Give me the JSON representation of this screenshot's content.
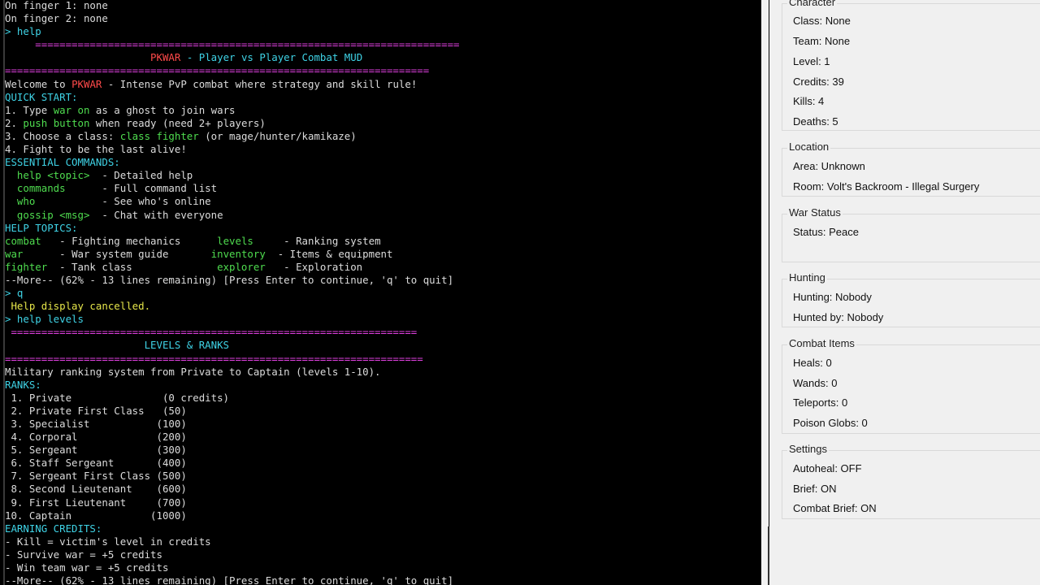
{
  "terminal": {
    "lines": [
      [
        {
          "t": "On finger 1: none",
          "c": "default"
        }
      ],
      [
        {
          "t": "On finger 2: none",
          "c": "default"
        }
      ],
      [
        {
          "t": "> help",
          "c": "cyan"
        }
      ],
      [
        {
          "t": "     ======================================================================",
          "c": "magenta"
        }
      ],
      [
        {
          "t": "                        ",
          "c": "default"
        },
        {
          "t": "PKWAR",
          "c": "red"
        },
        {
          "t": " - Player vs Player Combat MUD",
          "c": "cyan"
        }
      ],
      [
        {
          "t": "======================================================================",
          "c": "magenta"
        }
      ],
      [
        {
          "t": "Welcome to ",
          "c": "default"
        },
        {
          "t": "PKWAR",
          "c": "red"
        },
        {
          "t": " - Intense PvP combat where strategy and skill rule!",
          "c": "default"
        }
      ],
      [
        {
          "t": "QUICK START:",
          "c": "cyan"
        }
      ],
      [
        {
          "t": "1. Type ",
          "c": "default"
        },
        {
          "t": "war on",
          "c": "green"
        },
        {
          "t": " as a ghost to join wars",
          "c": "default"
        }
      ],
      [
        {
          "t": "2. ",
          "c": "default"
        },
        {
          "t": "push button",
          "c": "green"
        },
        {
          "t": " when ready (need 2+ players)",
          "c": "default"
        }
      ],
      [
        {
          "t": "3. Choose a class: ",
          "c": "default"
        },
        {
          "t": "class fighter",
          "c": "green"
        },
        {
          "t": " (or mage/hunter/kamikaze)",
          "c": "default"
        }
      ],
      [
        {
          "t": "4. Fight to be the last alive!",
          "c": "default"
        }
      ],
      [
        {
          "t": "ESSENTIAL COMMANDS:",
          "c": "cyan"
        }
      ],
      [
        {
          "t": "  help <topic>",
          "c": "green"
        },
        {
          "t": "  - Detailed help",
          "c": "default"
        }
      ],
      [
        {
          "t": "  commands",
          "c": "green"
        },
        {
          "t": "      - Full command list",
          "c": "default"
        }
      ],
      [
        {
          "t": "  who",
          "c": "green"
        },
        {
          "t": "           - See who's online",
          "c": "default"
        }
      ],
      [
        {
          "t": "  gossip <msg>",
          "c": "green"
        },
        {
          "t": "  - Chat with everyone",
          "c": "default"
        }
      ],
      [
        {
          "t": "HELP TOPICS:",
          "c": "cyan"
        }
      ],
      [
        {
          "t": "combat",
          "c": "green"
        },
        {
          "t": "   - Fighting mechanics      ",
          "c": "default"
        },
        {
          "t": "levels",
          "c": "green"
        },
        {
          "t": "     - Ranking system",
          "c": "default"
        }
      ],
      [
        {
          "t": "war",
          "c": "green"
        },
        {
          "t": "      - War system guide       ",
          "c": "default"
        },
        {
          "t": "inventory",
          "c": "green"
        },
        {
          "t": "  - Items & equipment",
          "c": "default"
        }
      ],
      [
        {
          "t": "fighter",
          "c": "green"
        },
        {
          "t": "  - Tank class              ",
          "c": "default"
        },
        {
          "t": "explorer",
          "c": "green"
        },
        {
          "t": "   - Exploration",
          "c": "default"
        }
      ],
      [
        {
          "t": "--More-- (62% - 13 lines remaining) [Press Enter to continue, 'q' to quit]",
          "c": "default"
        }
      ],
      [
        {
          "t": "> q",
          "c": "cyan"
        }
      ],
      [
        {
          "t": " Help display cancelled.",
          "c": "yellow"
        }
      ],
      [
        {
          "t": "> help levels",
          "c": "cyan"
        }
      ],
      [
        {
          "t": " ===================================================================",
          "c": "magenta"
        }
      ],
      [
        {
          "t": "                       LEVELS & RANKS",
          "c": "cyan"
        }
      ],
      [
        {
          "t": "=====================================================================",
          "c": "magenta"
        }
      ],
      [
        {
          "t": "Military ranking system from Private to Captain (levels 1-10).",
          "c": "default"
        }
      ],
      [
        {
          "t": "RANKS:",
          "c": "cyan"
        }
      ],
      [
        {
          "t": " 1. Private               (0 credits)",
          "c": "default"
        }
      ],
      [
        {
          "t": " 2. Private First Class   (50)",
          "c": "default"
        }
      ],
      [
        {
          "t": " 3. Specialist           (100)",
          "c": "default"
        }
      ],
      [
        {
          "t": " 4. Corporal             (200)",
          "c": "default"
        }
      ],
      [
        {
          "t": " 5. Sergeant             (300)",
          "c": "default"
        }
      ],
      [
        {
          "t": " 6. Staff Sergeant       (400)",
          "c": "default"
        }
      ],
      [
        {
          "t": " 7. Sergeant First Class (500)",
          "c": "default"
        }
      ],
      [
        {
          "t": " 8. Second Lieutenant    (600)",
          "c": "default"
        }
      ],
      [
        {
          "t": " 9. First Lieutenant     (700)",
          "c": "default"
        }
      ],
      [
        {
          "t": "10. Captain             (1000)",
          "c": "default"
        }
      ],
      [
        {
          "t": "EARNING CREDITS:",
          "c": "cyan"
        }
      ],
      [
        {
          "t": "- Kill = victim's level in credits",
          "c": "default"
        }
      ],
      [
        {
          "t": "- Survive war = +5 credits",
          "c": "default"
        }
      ],
      [
        {
          "t": "- Win team war = +5 credits",
          "c": "default"
        }
      ],
      [
        {
          "t": "--More-- (62% - 13 lines remaining) [Press Enter to continue, 'q' to quit]",
          "c": "default"
        }
      ]
    ]
  },
  "sidebar": {
    "character": {
      "title": "Character",
      "class": "Class: None",
      "team": "Team: None",
      "level": "Level: 1",
      "credits": "Credits: 39",
      "kills": "Kills: 4",
      "deaths": "Deaths: 5"
    },
    "location": {
      "title": "Location",
      "area": "Area: Unknown",
      "room": "Room: Volt's Backroom - Illegal Surgery"
    },
    "war_status": {
      "title": "War Status",
      "status": "Status: Peace"
    },
    "hunting": {
      "title": "Hunting",
      "hunting": "Hunting: Nobody",
      "hunted_by": "Hunted by: Nobody"
    },
    "combat_items": {
      "title": "Combat Items",
      "heals": "Heals: 0",
      "wands": "Wands: 0",
      "teleports": "Teleports: 0",
      "poison_globs": "Poison Globs: 0"
    },
    "settings": {
      "title": "Settings",
      "autoheal": "Autoheal: OFF",
      "brief": "Brief: ON",
      "combat_brief": "Combat Brief: ON"
    }
  }
}
